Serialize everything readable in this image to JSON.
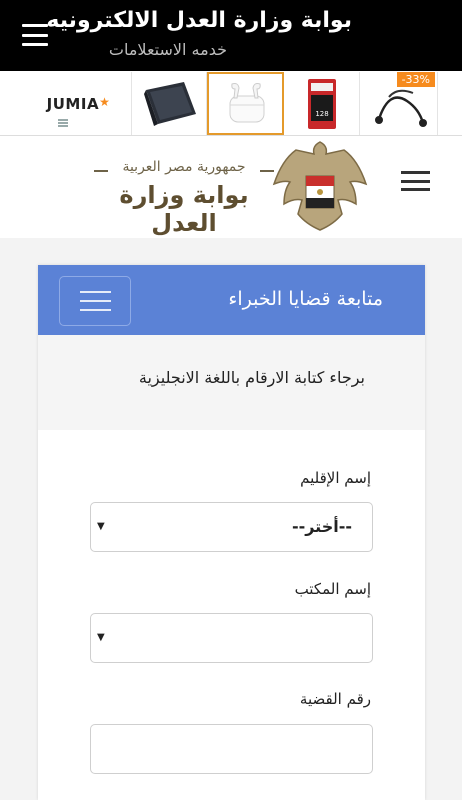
{
  "app_bar": {
    "title": "بوابة وزارة العدل الالكترونيه",
    "subtitle": "خدمه الاستعلامات"
  },
  "ads": {
    "brand": "JUMIA",
    "brand_mark": "★",
    "discount_badge": "-33%",
    "tiles": [
      "jumia-logo",
      "laptop-case",
      "wireless-earbuds",
      "memory-card",
      "earphones"
    ]
  },
  "header": {
    "logo_line1": "جمهورية مصر العربية",
    "logo_line2": "بوابة وزارة العدل"
  },
  "card": {
    "title": "متابعة قضايا الخبراء",
    "notice": "برجاء كتابة الارقام باللغة الانجليزية",
    "fields": [
      {
        "label": "إسم الإقليم",
        "value": "--أختر--",
        "type": "select"
      },
      {
        "label": "إسم المكتب",
        "value": "",
        "type": "select"
      },
      {
        "label": "رقم القضية",
        "value": "",
        "type": "text"
      }
    ]
  },
  "colors": {
    "app_bar": "#000000",
    "card_header": "#5b82d6",
    "selected_tile_border": "#e49a2b",
    "page_bg": "#f3f3f3"
  }
}
